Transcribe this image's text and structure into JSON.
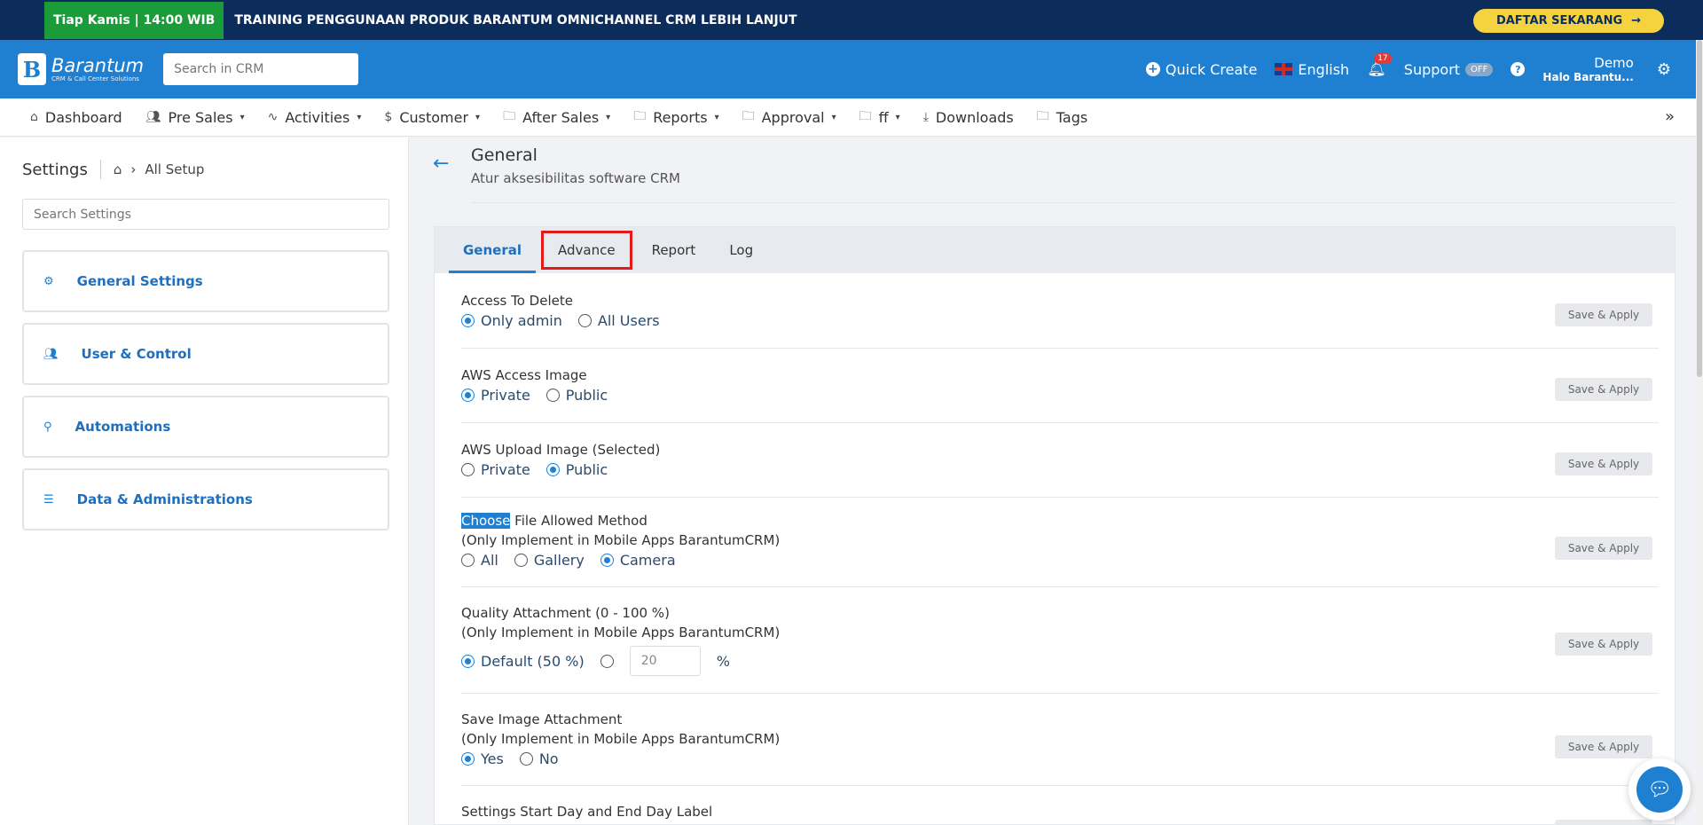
{
  "banner": {
    "badge": "Tiap Kamis | 14:00 WIB",
    "text": "TRAINING PENGGUNAAN PRODUK BARANTUM OMNICHANNEL CRM LEBIH LANJUT",
    "cta": "DAFTAR SEKARANG",
    "cta_icon": "arrow-right-icon"
  },
  "header": {
    "logo_name": "Barantum",
    "logo_sub": "CRM & Call Center Solutions",
    "search_placeholder": "Search in CRM",
    "quick_create": "Quick Create",
    "language": "English",
    "notif_count": "17",
    "support": "Support",
    "support_toggle": "OFF",
    "user_name": "Demo",
    "user_sub": "Halo Barantu..."
  },
  "nav": [
    {
      "label": "Dashboard",
      "icon": "home-icon",
      "dropdown": false
    },
    {
      "label": "Pre Sales",
      "icon": "users-icon",
      "dropdown": true
    },
    {
      "label": "Activities",
      "icon": "activity-icon",
      "dropdown": true
    },
    {
      "label": "Customer",
      "icon": "dollar-icon",
      "dropdown": true
    },
    {
      "label": "After Sales",
      "icon": "folder-icon",
      "dropdown": true
    },
    {
      "label": "Reports",
      "icon": "folder-icon",
      "dropdown": true
    },
    {
      "label": "Approval",
      "icon": "folder-icon",
      "dropdown": true
    },
    {
      "label": "ff",
      "icon": "folder-icon",
      "dropdown": true
    },
    {
      "label": "Downloads",
      "icon": "download-icon",
      "dropdown": false
    },
    {
      "label": "Tags",
      "icon": "folder-icon",
      "dropdown": false
    }
  ],
  "sidebar": {
    "title": "Settings",
    "crumb": "All Setup",
    "search_placeholder": "Search Settings",
    "cards": [
      {
        "label": "General Settings",
        "icon": "gear-icon"
      },
      {
        "label": "User & Control",
        "icon": "users-icon"
      },
      {
        "label": "Automations",
        "icon": "sitemap-icon"
      },
      {
        "label": "Data & Administrations",
        "icon": "database-icon"
      }
    ]
  },
  "main": {
    "title": "General",
    "subtitle": "Atur aksesibilitas software CRM",
    "tabs": [
      "General",
      "Advance",
      "Report",
      "Log"
    ],
    "save_label": "Save & Apply",
    "rows": {
      "r1": {
        "label": "Access To Delete",
        "opt1": "Only admin",
        "opt2": "All Users"
      },
      "r2": {
        "label": "AWS Access Image",
        "opt1": "Private",
        "opt2": "Public"
      },
      "r3": {
        "label": "AWS Upload Image (Selected)",
        "opt1": "Private",
        "opt2": "Public"
      },
      "r4": {
        "label_sel": "Choose",
        "label_rest": " File Allowed Method",
        "sub": "(Only Implement in Mobile Apps BarantumCRM)",
        "opt1": "All",
        "opt2": "Gallery",
        "opt3": "Camera"
      },
      "r5": {
        "label": "Quality Attachment (0 - 100 %)",
        "sub": "(Only Implement in Mobile Apps BarantumCRM)",
        "opt1": "Default (50 %)",
        "value": "20",
        "unit": "%"
      },
      "r6": {
        "label": "Save Image Attachment",
        "sub": "(Only Implement in Mobile Apps BarantumCRM)",
        "opt1": "Yes",
        "opt2": "No"
      },
      "r7": {
        "label": "Settings Start Day and End Day Label"
      }
    }
  }
}
